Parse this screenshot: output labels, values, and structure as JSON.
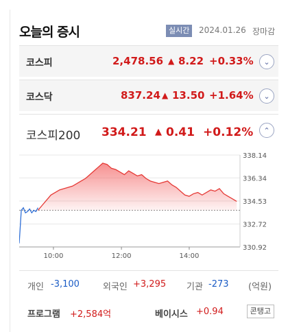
{
  "header": {
    "title": "오늘의 증시",
    "badge": "실시간",
    "date": "2024.01.26",
    "status": "장마감"
  },
  "rows": [
    {
      "name": "코스피",
      "value": "2,478.56",
      "arrow": "▲",
      "change": "8.22",
      "percent": "+0.33%",
      "toggle_icon": "chevron-down-icon"
    },
    {
      "name": "코스닥",
      "value": "837.24",
      "arrow": "▲",
      "change": "13.50",
      "percent": "+1.64%",
      "toggle_icon": "chevron-down-icon"
    }
  ],
  "kospi200": {
    "name": "코스피200",
    "value": "334.21",
    "arrow": "▲",
    "change": "0.41",
    "percent": "+0.12%",
    "toggle_icon": "chevron-up-icon"
  },
  "chart_data": {
    "type": "area",
    "y_ticks": [
      "338.14",
      "336.34",
      "334.53",
      "332.72",
      "330.92"
    ],
    "x_ticks": [
      "10:00",
      "12:00",
      "14:00"
    ],
    "ylim": [
      330.92,
      338.14
    ],
    "reference_value": 333.8,
    "colors": {
      "up": "#e53935",
      "down": "#2f6fd6",
      "fill_top": "#f36b6b"
    },
    "series": [
      {
        "values": [
          331.2,
          333.8,
          334.0,
          333.6,
          333.7,
          333.9,
          333.6,
          333.8,
          333.7,
          334.0
        ]
      },
      {
        "values": [
          333.8,
          334.2,
          334.6,
          335.0,
          335.2,
          335.4,
          335.5,
          335.6,
          335.7,
          335.9,
          336.1,
          336.3,
          336.6,
          336.9,
          337.2,
          337.5,
          337.4,
          337.1,
          337.0,
          336.8,
          336.6,
          336.9,
          336.7,
          336.5,
          336.6,
          336.3,
          336.1,
          336.0,
          335.9,
          336.0,
          336.1,
          335.8,
          335.6,
          335.3,
          335.0,
          334.9,
          335.1,
          335.2,
          335.0,
          335.2,
          335.4,
          335.3,
          335.5,
          335.1,
          334.9,
          334.7,
          334.5
        ]
      }
    ]
  },
  "investors": {
    "individual_label": "개인",
    "individual_value": "-3,100",
    "foreign_label": "외국인",
    "foreign_value": "+3,295",
    "institution_label": "기관",
    "institution_value": "-273",
    "unit": "(억원)"
  },
  "program": {
    "label": "프로그램",
    "value": "+2,584억",
    "basis_label": "베이시스",
    "basis_value": "+0.94",
    "contango_label": "콘탱고"
  }
}
